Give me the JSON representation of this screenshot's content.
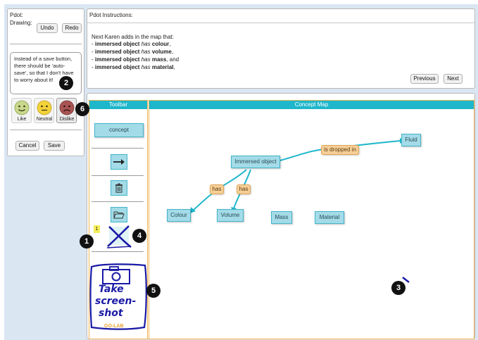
{
  "left_panel": {
    "title": "Pdot:",
    "drawing_label": "Drawing:",
    "undo_label": "Undo",
    "redo_label": "Redo",
    "comment_text": "Instead of a save button, there should be 'auto-save', so that I don't have to worry about it!",
    "ratings": [
      {
        "label": "Like",
        "color": "#c8d88c"
      },
      {
        "label": "Neutral",
        "color": "#f3d23a"
      },
      {
        "label": "Dislike",
        "color": "#a85452"
      }
    ],
    "cancel_label": "Cancel",
    "save_label": "Save"
  },
  "instructions": {
    "title": "Pdot Instructions:",
    "intro": "Next Karen adds in the map that:",
    "items": [
      {
        "dash": "- ",
        "subject": "immersed object",
        "verb": "has",
        "object": "colour",
        "end": ","
      },
      {
        "dash": "- ",
        "subject": "immersed object",
        "verb": "has",
        "object": "volume",
        "end": ","
      },
      {
        "dash": "- ",
        "subject": "immersed object",
        "verb": "has",
        "object": "mass",
        "end": ", and"
      },
      {
        "dash": "- ",
        "subject": "immersed object",
        "verb": "has",
        "object": "material",
        "end": ","
      }
    ],
    "previous_label": "Previous",
    "next_label": "Next"
  },
  "toolbar": {
    "title": "Toolbar",
    "concept_label": "concept",
    "small_badge": "1",
    "sketch_lines": [
      "Take",
      "screen-",
      "shot"
    ],
    "brand": "GO-LAB"
  },
  "concept_map": {
    "title": "Concept Map",
    "nodes": [
      "Immersed object",
      "Fluid",
      "Colour",
      "Volume",
      "Mass",
      "Material"
    ],
    "links": [
      "is dropped in",
      "has",
      "has"
    ]
  },
  "markers": [
    "1",
    "2",
    "3",
    "4",
    "5",
    "6"
  ],
  "colors": {
    "header_teal": "#1eb6cb",
    "section_border": "#f2b452",
    "node_fill": "#a3dce8",
    "node_border": "#44b4ca",
    "link_fill": "#f6cf97",
    "sketch_ink": "#1a1aa6"
  }
}
